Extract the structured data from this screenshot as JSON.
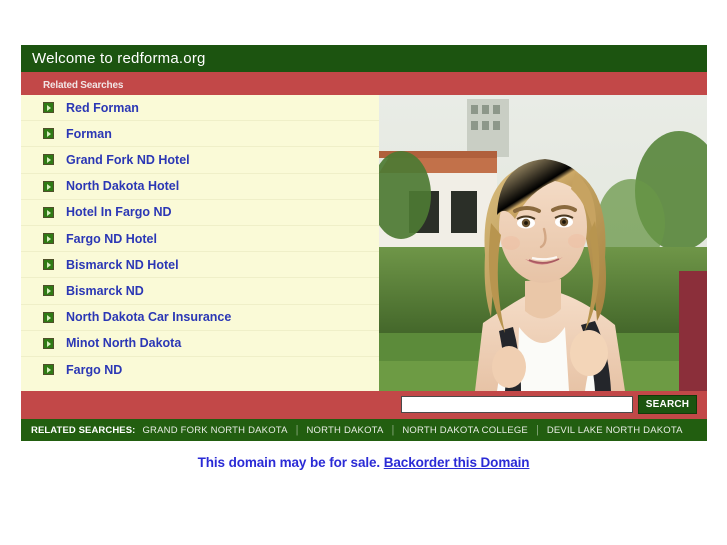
{
  "header": {
    "welcome_title": "Welcome to redforma.org",
    "related_searches_label": "Related Searches"
  },
  "related_links": [
    {
      "label": "Red Forman"
    },
    {
      "label": "Forman"
    },
    {
      "label": "Grand Fork ND Hotel"
    },
    {
      "label": "North Dakota Hotel"
    },
    {
      "label": "Hotel In Fargo ND"
    },
    {
      "label": "Fargo ND Hotel"
    },
    {
      "label": "Bismarck ND Hotel"
    },
    {
      "label": "Bismarck ND"
    },
    {
      "label": "North Dakota Car Insurance"
    },
    {
      "label": "Minot North Dakota"
    },
    {
      "label": "Fargo ND"
    }
  ],
  "search": {
    "value": "",
    "placeholder": "",
    "button_label": "SEARCH"
  },
  "footer": {
    "label": "RELATED SEARCHES:",
    "separator": "|",
    "terms": [
      "GRAND FORK NORTH DAKOTA",
      "NORTH DAKOTA",
      "NORTH DAKOTA COLLEGE",
      "DEVIL LAKE NORTH DAKOTA"
    ]
  },
  "sale": {
    "text": "This domain may be for sale.",
    "link_label": "Backorder this Domain"
  },
  "photo": {
    "alt": "Smiling blonde young woman wearing a white tank top and a black backpack, standing outdoors in front of a campus building and green hedges"
  },
  "colors": {
    "green": "#1c5410",
    "red": "#c24848",
    "cream": "#fafad7",
    "link_blue": "#2b37b5",
    "footer_green": "#225e10",
    "sale_blue": "#2b2bd6"
  }
}
